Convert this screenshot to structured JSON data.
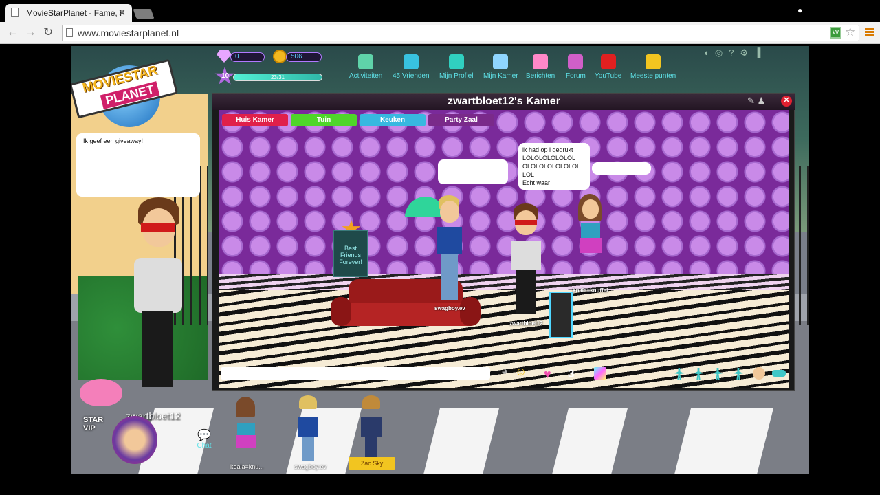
{
  "browser": {
    "tab_title": "MovieStarPlanet - Fame, F",
    "url": "www.moviestarplanet.nl"
  },
  "logo": {
    "line1": "MOVIESTAR",
    "line2": "PLANET"
  },
  "currency": {
    "diamonds": "0",
    "coins": "506",
    "level": "10",
    "fame_label": "23/31"
  },
  "nav": [
    {
      "label": "Activiteiten",
      "color": "#5fd3a9"
    },
    {
      "label": "45 Vrienden",
      "color": "#38c2e0"
    },
    {
      "label": "Mijn Profiel",
      "color": "#30d0c0"
    },
    {
      "label": "Mijn Kamer",
      "color": "#8fd6ff"
    },
    {
      "label": "Berichten",
      "color": "#ff88c8"
    },
    {
      "label": "Forum",
      "color": "#d05fc8"
    },
    {
      "label": "YouTube",
      "color": "#e02020"
    },
    {
      "label": "Meeste punten",
      "color": "#f2c520"
    }
  ],
  "room": {
    "title": "zwartbloet12's Kamer",
    "tabs": [
      {
        "label": "Huis Kamer",
        "color": "#e0204a"
      },
      {
        "label": "Tuin",
        "color": "#4fd62a"
      },
      {
        "label": "Keuken",
        "color": "#38b8e0"
      },
      {
        "label": "Party Zaal",
        "color": "#7a2a8a"
      }
    ],
    "bff_sign": "Best Friends Forever!",
    "bubble_left": "",
    "bubble_center": "ik had op l gedrukt\nLOLOLOLOLOLOL\nOLOLOLOLOLOLOL\nLOL\nEcht waar",
    "bubble_right": "",
    "avatars": [
      {
        "name": "swagboy.ev"
      },
      {
        "name": "zwartbloet12"
      },
      {
        "name": "koala=knuffel"
      }
    ],
    "heart_count": "3"
  },
  "left_bubble": "Ik geef een giveaway!",
  "hud": {
    "player_name": "zwartbloet12",
    "chat_label": "Chat",
    "vip_text": "STAR VIP",
    "friends": [
      {
        "name": "koala=knu..."
      },
      {
        "name": "swagboy.ev"
      },
      {
        "name": "Zac Sky"
      }
    ]
  }
}
